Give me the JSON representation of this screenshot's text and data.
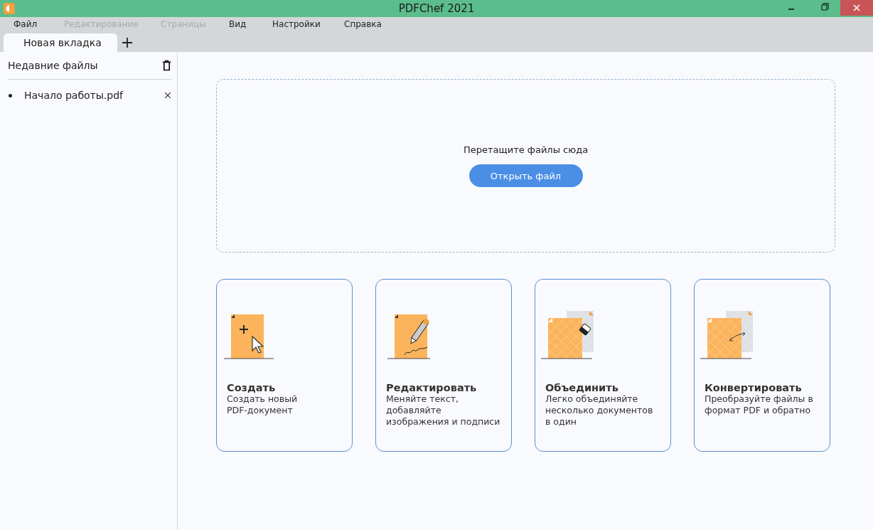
{
  "window": {
    "title": "PDFChef 2021"
  },
  "menu": [
    {
      "label": "Файл",
      "disabled": false
    },
    {
      "label": "Редактирование",
      "disabled": true
    },
    {
      "label": "Страницы",
      "disabled": true
    },
    {
      "label": "Вид",
      "disabled": false
    },
    {
      "label": "Настройки",
      "disabled": false
    },
    {
      "label": "Справка",
      "disabled": false
    }
  ],
  "tabs": [
    {
      "label": "Новая вкладка",
      "selected": true
    }
  ],
  "sidebar": {
    "title": "Недавние файлы",
    "items": [
      {
        "label": "Начало работы.pdf"
      }
    ]
  },
  "dropzone": {
    "text": "Перетащите файлы сюда",
    "button": "Открыть файл"
  },
  "cards": [
    {
      "kind": "create",
      "title": "Создать",
      "description_lines": [
        "Создать новый",
        "PDF-документ"
      ]
    },
    {
      "kind": "edit",
      "title": "Редактировать",
      "description_lines": [
        "Меняйте текст,",
        "добавляйте",
        "изображения и подписи"
      ]
    },
    {
      "kind": "merge",
      "title": "Объединить",
      "description_lines": [
        "Легко объединяйте",
        "несколько документов",
        "в один"
      ]
    },
    {
      "kind": "convert",
      "title": "Конвертировать",
      "description_lines": [
        "Преобразуйте файлы в",
        "формат PDF и обратно"
      ]
    }
  ]
}
